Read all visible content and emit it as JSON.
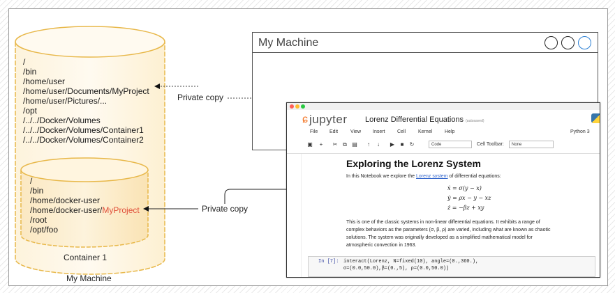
{
  "host": {
    "label": "My Machine",
    "paths": [
      "/",
      "/bin",
      "/home/user",
      "/home/user/Documents/MyProject",
      "/home/user/Pictures/...",
      "/opt",
      "/../../Docker/Volumes",
      "/../../Docker/Volumes/Container1",
      "/../../Docker/Volumes/Container2"
    ]
  },
  "container": {
    "label": "Container 1",
    "paths": [
      "/",
      "/bin",
      "/home/docker-user",
      "/root",
      "/opt/foo"
    ],
    "project_prefix": "/home/docker-user/",
    "project_name": "MyProject"
  },
  "private_copy_label_top": "Private copy",
  "private_copy_label_bottom": "Private copy",
  "window": {
    "title": "My Machine"
  },
  "notebook": {
    "logo": "jupyter",
    "title": "Lorenz Differential Equations",
    "saved": "(autosaved)",
    "menu": [
      "File",
      "Edit",
      "View",
      "Insert",
      "Cell",
      "Kernel",
      "Help"
    ],
    "kernel": "Python 3",
    "toolbar_icons": [
      "save-icon",
      "add-cell-icon",
      "cut-icon",
      "copy-icon",
      "paste-icon",
      "move-up-icon",
      "move-down-icon",
      "run-icon",
      "stop-icon",
      "restart-icon"
    ],
    "cell_type": "Code",
    "cell_toolbar_label": "Cell Toolbar:",
    "cell_toolbar_value": "None",
    "heading": "Exploring the Lorenz System",
    "intro_before": "In this Notebook we explore the ",
    "intro_link": "Lorenz system",
    "intro_after": " of differential equations:",
    "equations": [
      "ẋ = σ(y − x)",
      "ẏ = ρx − y − xz",
      "ż = −βz + xy"
    ],
    "body_lines": [
      "This is one of the classic systems in non-linear differential equations. It exhibits a range of",
      "complex behaviors as the parameters (σ, β, ρ) are varied, including what are known as chaotic",
      "solutions. The system was originally developed as a simplified mathematical model for",
      "atmospheric convection in 1963."
    ],
    "prompt": "In [7]:",
    "code_lines": [
      "interact(Lorenz, N=fixed(10), angle=(0.,360.),",
      "         σ=(0.0,50.0),β=(0.,5), ρ=(0.0,50.0))"
    ]
  },
  "colors": {
    "cylinder_fill": "#fdf3dc",
    "cylinder_stroke": "#e8b84a",
    "container_highlight": "#e0503a",
    "jupyter_orange": "#f37626",
    "link_blue": "#3366cc"
  }
}
